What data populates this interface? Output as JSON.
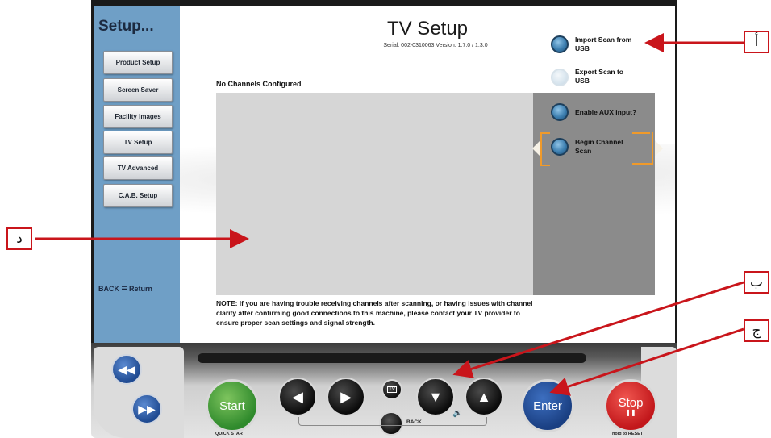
{
  "sidebar": {
    "title": "Setup...",
    "items": [
      {
        "label": "Product Setup"
      },
      {
        "label": "Screen Saver"
      },
      {
        "label": "Facility Images"
      },
      {
        "label": "TV Setup"
      },
      {
        "label": "TV Advanced"
      },
      {
        "label": "C.A.B. Setup"
      }
    ],
    "back_label": "BACK",
    "back_equals": "=",
    "back_action": "Return"
  },
  "main": {
    "title": "TV Setup",
    "serial": "Serial: 002-0310063  Version: 1.7.0 / 1.3.0",
    "channels_status": "No Channels Configured",
    "note": "NOTE: If you are having trouble receiving channels after scanning, or having issues with channel clarity after confirming good connections to this machine, please contact your TV provider to ensure proper scan settings and signal strength."
  },
  "options": [
    {
      "label": "Import Scan from USB",
      "state": "enabled"
    },
    {
      "label": "Export Scan to USB",
      "state": "disabled"
    },
    {
      "label": "Enable AUX input?",
      "state": "enabled"
    },
    {
      "label": "Begin Channel Scan",
      "state": "selected"
    }
  ],
  "console": {
    "start_label": "Start",
    "start_sub": "QUICK START",
    "enter_label": "Enter",
    "stop_label": "Stop",
    "stop_sub": "hold to RESET",
    "back_label": "BACK",
    "tv_label": "TV"
  },
  "annotations": {
    "a": "أ",
    "b": "ب",
    "c": "ج",
    "d": "د"
  },
  "colors": {
    "sidebar": "#6f9fc6",
    "selection": "#f09a2a",
    "annotation": "#c9151b",
    "start": "#2f8a2c",
    "enter": "#1a3f82",
    "stop": "#c2171b"
  }
}
